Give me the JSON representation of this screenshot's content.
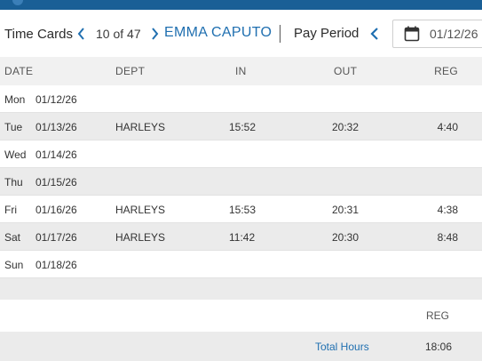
{
  "header": {
    "title": "Time Cards",
    "record_count": "10 of 47",
    "employee_name": "EMMA CAPUTO",
    "pay_period_label": "Pay Period",
    "pay_period_date": "01/12/26"
  },
  "table": {
    "columns": [
      "DATE",
      "DEPT",
      "IN",
      "OUT",
      "REG"
    ],
    "rows": [
      {
        "day": "Mon",
        "date": "01/12/26",
        "dept": "",
        "in": "",
        "out": "",
        "reg": ""
      },
      {
        "day": "Tue",
        "date": "01/13/26",
        "dept": "HARLEYS",
        "in": "15:52",
        "out": "20:32",
        "reg": "4:40"
      },
      {
        "day": "Wed",
        "date": "01/14/26",
        "dept": "",
        "in": "",
        "out": "",
        "reg": ""
      },
      {
        "day": "Thu",
        "date": "01/15/26",
        "dept": "",
        "in": "",
        "out": "",
        "reg": ""
      },
      {
        "day": "Fri",
        "date": "01/16/26",
        "dept": "HARLEYS",
        "in": "15:53",
        "out": "20:31",
        "reg": "4:38"
      },
      {
        "day": "Sat",
        "date": "01/17/26",
        "dept": "HARLEYS",
        "in": "11:42",
        "out": "20:30",
        "reg": "8:48"
      },
      {
        "day": "Sun",
        "date": "01/18/26",
        "dept": "",
        "in": "",
        "out": "",
        "reg": ""
      }
    ]
  },
  "summary": {
    "reg_header": "REG",
    "total_label": "Total Hours",
    "total_reg": "18:06"
  },
  "icons": {
    "prev": "chevron-left-icon",
    "next": "chevron-right-icon",
    "calendar": "calendar-icon"
  },
  "colors": {
    "brand_bar": "#1a5f96",
    "accent": "#1f6fb0",
    "row_alt": "#ebebeb"
  }
}
